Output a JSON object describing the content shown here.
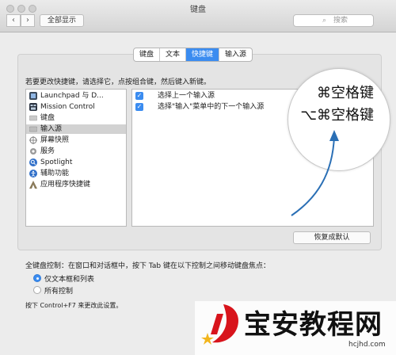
{
  "window": {
    "title": "键盘"
  },
  "toolbar": {
    "back": "‹",
    "forward": "›",
    "show_all": "全部显示",
    "search_placeholder": "搜索",
    "search_icon": "magnifier-icon"
  },
  "tabs": [
    "键盘",
    "文本",
    "快捷键",
    "输入源"
  ],
  "active_tab": "快捷键",
  "instruction": "若要更改快捷键，请选择它，点按组合键，然后键入新键。",
  "categories": [
    {
      "label": "Launchpad 与 D...",
      "icon": "launchpad-icon"
    },
    {
      "label": "Mission Control",
      "icon": "mission-control-icon"
    },
    {
      "label": "键盘",
      "icon": "keyboard-icon"
    },
    {
      "label": "输入源",
      "icon": "input-source-icon",
      "selected": true
    },
    {
      "label": "屏幕快照",
      "icon": "screenshot-icon"
    },
    {
      "label": "服务",
      "icon": "services-gear-icon"
    },
    {
      "label": "Spotlight",
      "icon": "spotlight-icon"
    },
    {
      "label": "辅助功能",
      "icon": "accessibility-icon"
    },
    {
      "label": "应用程序快捷键",
      "icon": "app-shortcuts-icon"
    }
  ],
  "shortcuts": [
    {
      "checked": true,
      "label": "选择上一个输入源"
    },
    {
      "checked": true,
      "label": "选择\"输入\"菜单中的下一个输入源"
    }
  ],
  "magnifier": {
    "line1": "⌘空格键",
    "line2": "⌥⌘空格键"
  },
  "restore_button": "恢复成默认",
  "full_keyboard_access": "全键盘控制：在窗口和对话框中，按下 Tab 键在以下控制之间移动键盘焦点：",
  "radios": [
    {
      "label": "仅文本框和列表",
      "selected": true
    },
    {
      "label": "所有控制",
      "selected": false
    }
  ],
  "hint": "按下 Control+F7 来更改此设置。",
  "watermark": {
    "text": "宝安教程网",
    "url": "hcjhd.com"
  },
  "colors": {
    "accent": "#3b8cf0",
    "arrow": "#2a6fb5"
  }
}
